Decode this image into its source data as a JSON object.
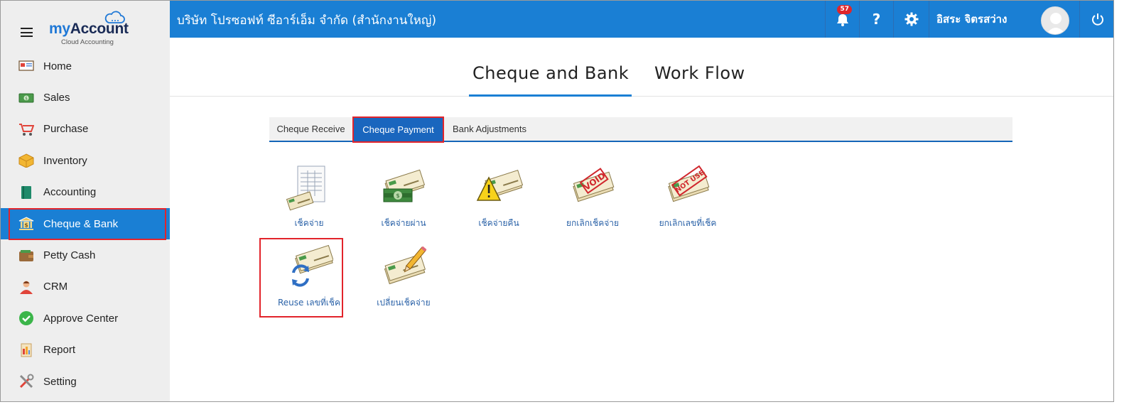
{
  "brand": {
    "name_my": "my",
    "name_account": "Account",
    "subtitle": "Cloud Accounting"
  },
  "sidebar": {
    "items": [
      {
        "label": "Home",
        "icon": "home-icon"
      },
      {
        "label": "Sales",
        "icon": "money-icon"
      },
      {
        "label": "Purchase",
        "icon": "cart-icon"
      },
      {
        "label": "Inventory",
        "icon": "box-icon"
      },
      {
        "label": "Accounting",
        "icon": "book-icon"
      },
      {
        "label": "Cheque & Bank",
        "icon": "bank-icon",
        "active": true
      },
      {
        "label": "Petty Cash",
        "icon": "wallet-icon"
      },
      {
        "label": "CRM",
        "icon": "people-icon"
      },
      {
        "label": "Approve Center",
        "icon": "check-circle-icon"
      },
      {
        "label": "Report",
        "icon": "report-icon"
      },
      {
        "label": "Setting",
        "icon": "tools-icon"
      }
    ]
  },
  "header": {
    "company": "บริษัท โปรซอฟท์ ซีอาร์เอ็ม จำกัด (สำนักงานใหญ่)",
    "notification_count": "57",
    "help_label": "?",
    "user_name": "อิสระ จิตรสว่าง"
  },
  "main_tabs": [
    {
      "label": "Cheque and Bank",
      "active": true
    },
    {
      "label": "Work Flow",
      "active": false
    }
  ],
  "sub_tabs": [
    {
      "label": "Cheque Receive",
      "active": false
    },
    {
      "label": "Cheque Payment",
      "active": true
    },
    {
      "label": "Bank Adjustments",
      "active": false
    }
  ],
  "items": [
    {
      "label": "เช็คจ่าย",
      "icon": "cheque-document-icon"
    },
    {
      "label": "เช็คจ่ายผ่าน",
      "icon": "cheque-cash-icon"
    },
    {
      "label": "เช็คจ่ายคืน",
      "icon": "cheque-warning-icon"
    },
    {
      "label": "ยกเลิกเช็คจ่าย",
      "icon": "cheque-void-icon",
      "stamp": "VOID"
    },
    {
      "label": "ยกเลิกเลขที่เช็ค",
      "icon": "cheque-not-use-icon",
      "stamp": "NOT USE"
    },
    {
      "label": "Reuse เลขที่เช็ค",
      "icon": "cheque-reuse-icon",
      "highlight": true
    },
    {
      "label": "เปลี่ยนเช็คจ่าย",
      "icon": "cheque-edit-icon"
    }
  ],
  "colors": {
    "primary": "#1a7fd4",
    "highlight": "#e2242b",
    "sidebar_bg": "#eeeeee"
  }
}
